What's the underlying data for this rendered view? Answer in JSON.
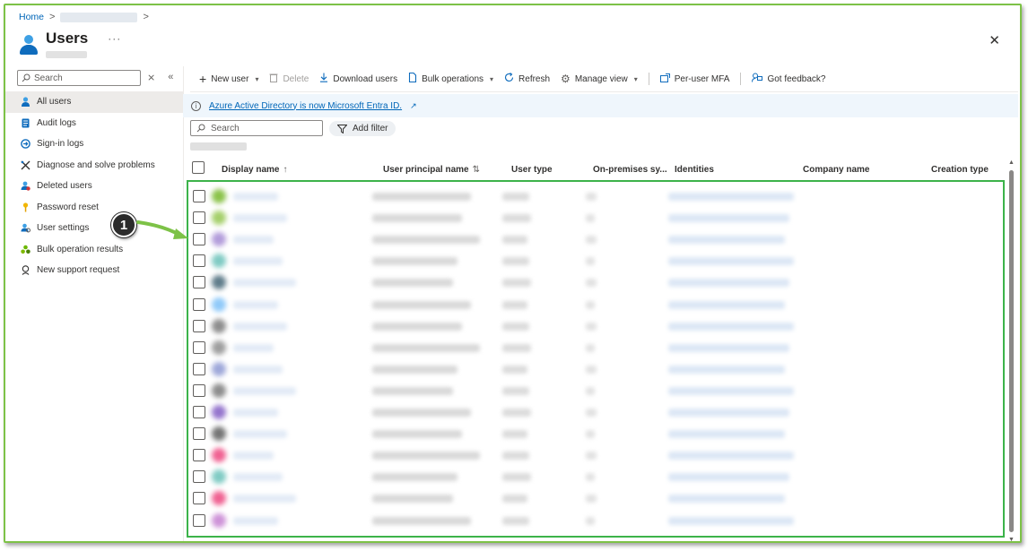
{
  "breadcrumb": {
    "home": "Home",
    "sep": ">"
  },
  "header": {
    "title": "Users",
    "more": "···",
    "close": "✕"
  },
  "sidebar": {
    "search_placeholder": "Search",
    "items": [
      {
        "label": "All users",
        "icon": "user-icon",
        "active": true
      },
      {
        "label": "Audit logs",
        "icon": "audit-log-icon"
      },
      {
        "label": "Sign-in logs",
        "icon": "sign-in-icon"
      },
      {
        "label": "Diagnose and solve problems",
        "icon": "wrench-icon"
      },
      {
        "label": "Deleted users",
        "icon": "deleted-user-icon"
      },
      {
        "label": "Password reset",
        "icon": "key-icon"
      },
      {
        "label": "User settings",
        "icon": "user-settings-icon"
      },
      {
        "label": "Bulk operation results",
        "icon": "bulk-results-icon"
      },
      {
        "label": "New support request",
        "icon": "support-icon"
      }
    ]
  },
  "toolbar": {
    "new_user": "New user",
    "delete": "Delete",
    "download": "Download users",
    "bulk": "Bulk operations",
    "refresh": "Refresh",
    "manage_view": "Manage view",
    "per_user_mfa": "Per-user MFA",
    "feedback": "Got feedback?"
  },
  "banner": {
    "text": "Azure Active Directory is now Microsoft Entra ID."
  },
  "filter": {
    "search_placeholder": "Search",
    "add_filter": "Add filter"
  },
  "table": {
    "columns": [
      "Display name",
      "User principal name",
      "User type",
      "On-premises sy...",
      "Identities",
      "Company name",
      "Creation type"
    ],
    "sort_display": "↑",
    "sort_upn": "⇅"
  },
  "callout": {
    "number": "1"
  },
  "colors": {
    "accent": "#0f6cbd",
    "highlight_border": "#3cb34a",
    "frame_border": "#7dc247"
  }
}
